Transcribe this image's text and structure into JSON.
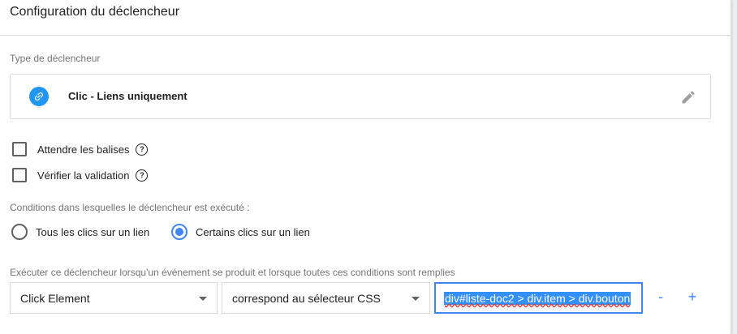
{
  "header": {
    "title": "Configuration du déclencheur"
  },
  "trigger_type": {
    "label": "Type de déclencheur",
    "name": "Clic - Liens uniquement",
    "icon": "link-icon",
    "icon_color": "#2196f3"
  },
  "options": {
    "wait_tags": "Attendre les balises",
    "check_validation": "Vérifier la validation"
  },
  "conditions": {
    "label": "Conditions dans lesquelles le déclencheur est exécuté :",
    "radio_all": "Tous les clics sur un lien",
    "radio_some": "Certains clics sur un lien",
    "selected": "radio_some"
  },
  "filter": {
    "label": "Exécuter ce déclencheur lorsqu'un événement se produit et lorsque toutes ces conditions sont remplies",
    "variable": "Click Element",
    "operator": "correspond au sélecteur CSS",
    "value": "div#liste-doc2 > div.item > div.bouton",
    "remove_label": "-",
    "add_label": "+"
  },
  "colors": {
    "accent": "#4285f4",
    "selection": "#3390ff"
  }
}
